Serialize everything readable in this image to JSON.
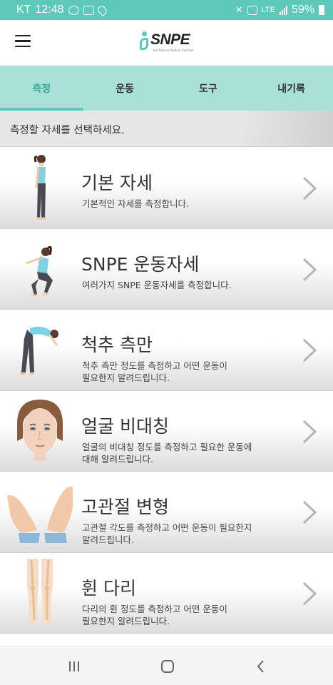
{
  "status_bar": {
    "carrier": "KT",
    "time": "12:48",
    "network": "LTE",
    "battery": "59%",
    "icons": [
      "talk-icon",
      "gallery-icon",
      "location-icon",
      "mute-icon",
      "volte-icon",
      "signal-icon",
      "battery-icon"
    ]
  },
  "header": {
    "brand": "SNPE",
    "brand_sub": "Self Natural Posture Exercise",
    "accent": "#5ec9bb"
  },
  "tabs": [
    {
      "label": "측정",
      "active": true
    },
    {
      "label": "운동",
      "active": false
    },
    {
      "label": "도구",
      "active": false
    },
    {
      "label": "내기록",
      "active": false
    }
  ],
  "instruction": "측정할 자세를 선택하세요.",
  "items": [
    {
      "title": "기본 자세",
      "desc": "기본적인 자세를 측정합니다.",
      "icon": "standing-woman-icon"
    },
    {
      "title": "SNPE 운동자세",
      "desc": "여러가지 SNPE 운동자세를 측정합니다.",
      "icon": "squat-woman-icon"
    },
    {
      "title": "척추 측만",
      "desc": "척추 측만 정도를 측정하고 어떤 운동이\n필요한지 알려드립니다.",
      "icon": "bending-woman-icon"
    },
    {
      "title": "얼굴 비대칭",
      "desc": "얼굴의 비대칭 정도를 측정하고 필요한 운동에\n대해 알려드립니다.",
      "icon": "face-icon"
    },
    {
      "title": "고관절 변형",
      "desc": "고관절 각도를 측정하고 어떤 운동이 필요한지\n알려드립니다.",
      "icon": "feet-icon"
    },
    {
      "title": "휜 다리",
      "desc": "다리의 휜 정도를 측정하고 어떤 운동이\n필요한지 알려드립니다.",
      "icon": "legs-bones-icon"
    }
  ],
  "nav": [
    "recent-apps-icon",
    "home-icon",
    "back-icon"
  ]
}
